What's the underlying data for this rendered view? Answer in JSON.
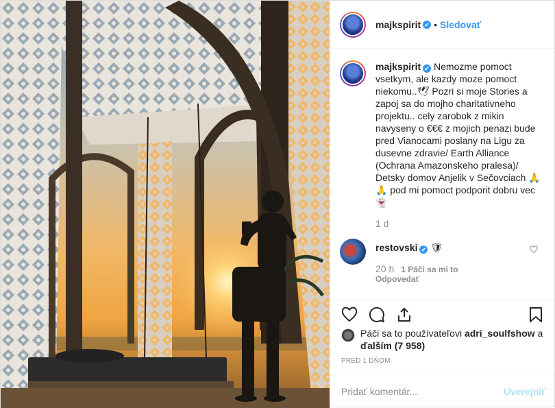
{
  "post": {
    "photo_alt": "photo-of-man-on-rooftop-swing-at-sunset"
  },
  "header": {
    "username": "majkspirit",
    "verified_badge": "✔",
    "separator": "•",
    "follow_label": "Sledovať"
  },
  "caption": {
    "username": "majkspirit",
    "text": "Nemozme pomoct vsetkym, ale kazdy moze pomoct niekomu..🕊 Pozri si moje Stories a zapoj sa do mojho charitativneho projektu.. cely zarobok z mikin navyseny o €€€ z mojich penazi bude pred Vianocami poslany na Ligu za dusevne zdravie/ Earth Alliance (Ochrana Amazonskeho pralesa)/ Detsky domov Anjelik v Sečovciach 🙏 🙏 pod mi pomoct podporit dobru vec 👻",
    "age": "1 d"
  },
  "comment": {
    "username": "restovski",
    "emoji": "🛡",
    "age": "20 h",
    "likes": "1 Páči sa mi to",
    "reply_label": "Odpovedať"
  },
  "likes": {
    "prefix": "Páči sa to používateľovi ",
    "user": "adri_soulfshow",
    "and": " a ",
    "others": "ďalším (7 958)"
  },
  "date": "PRED 1 DŇOM",
  "add_comment": {
    "placeholder": "Pridať komentár...",
    "post_label": "Uverejniť"
  },
  "colors": {
    "accent": "#3897f0",
    "sky_top": "#8fb0c8",
    "sunset": "#f5b55a",
    "muted": "#8e8e8e"
  }
}
